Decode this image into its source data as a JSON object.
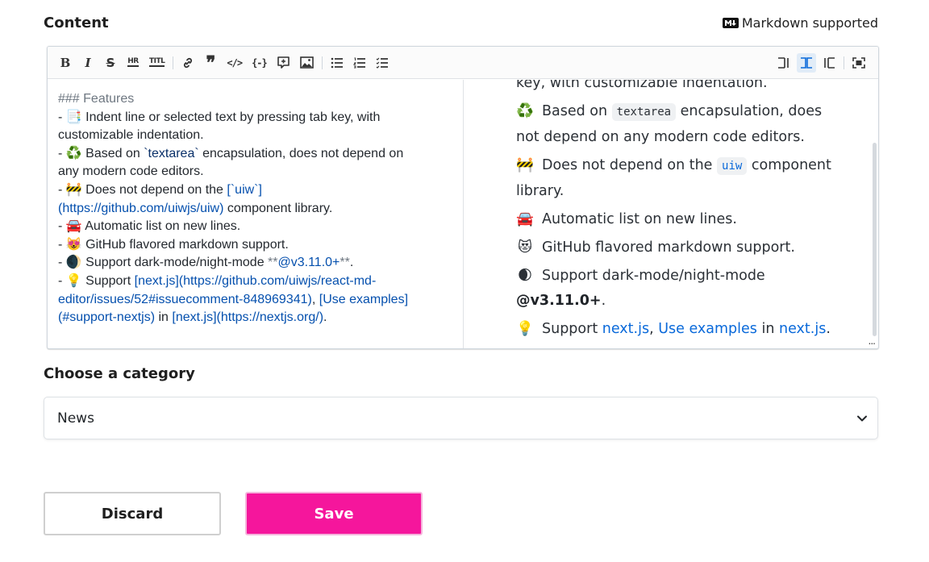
{
  "content_section": {
    "title": "Content",
    "markdown_supported": "Markdown supported"
  },
  "toolbar": {
    "bold": "B",
    "italic": "I",
    "strikethrough": "S",
    "hr": "HR",
    "title": "TITL",
    "quote": "99",
    "code": "</>",
    "codeblock": "{-}"
  },
  "editor": {
    "source": {
      "l1": "### Features",
      "l2_a": "- 📑 Indent line or selected text by pressing tab key, with",
      "l2_b": "customizable indentation.",
      "l3_a": "- ♻️ Based on ",
      "l3_code": "`textarea`",
      "l3_b": " encapsulation, does not depend on",
      "l3_c": "any modern code editors.",
      "l4_a": "- 🚧 Does not depend on the ",
      "l4_link1": "[`uiw`]",
      "l4_link2": "(https://github.com/uiwjs/uiw)",
      "l4_b": " component library.",
      "l5": "- 🚘 Automatic list on new lines.",
      "l6": "- 😻 GitHub flavored markdown support.",
      "l7_a": "- 🌒 Support dark-mode/night-mode ",
      "l7_s1": "**",
      "l7_at": "@v3.11.0+",
      "l7_s2": "**",
      "l7_end": ".",
      "l8_a": "- 💡 Support ",
      "l8_link1": "[next.js](https://github.com/uiwjs/react-md-",
      "l8_link2": "editor/issues/52#issuecomment-848969341)",
      "l8_comma": ", ",
      "l8_link3": "[Use examples]",
      "l8_link4": "(#support-nextjs)",
      "l8_in": " in ",
      "l8_link5": "[next.js](https://nextjs.org/)",
      "l8_end": "."
    },
    "preview": {
      "p0": "key, with customizable indentation.",
      "p1_emoji": "♻️",
      "p1_a": "Based on ",
      "p1_code": "textarea",
      "p1_b": " encapsulation, does not depend on any modern code editors.",
      "p2_emoji": "🚧",
      "p2_a": "Does not depend on the ",
      "p2_code": "uiw",
      "p2_b": " component library.",
      "p3_emoji": "🚘",
      "p3": "Automatic list on new lines.",
      "p4_emoji": "😻",
      "p4": "GitHub flavored markdown support.",
      "p5_emoji": "🌒",
      "p5_a": "Support dark-mode/night-mode ",
      "p5_strong": "@v3.11.0+",
      "p5_end": ".",
      "p6_emoji": "💡",
      "p6_a": "Support ",
      "p6_link1": "next.js",
      "p6_comma": ", ",
      "p6_link2": "Use examples",
      "p6_in": " in ",
      "p6_link3": "next.js",
      "p6_end": "."
    },
    "resize_handle": "..."
  },
  "category_section": {
    "title": "Choose a category",
    "selected": "News"
  },
  "actions": {
    "discard": "Discard",
    "save": "Save"
  },
  "colors": {
    "save_bg": "#f5169c",
    "link": "#0969da",
    "active_tool": "#e1ecf7"
  }
}
